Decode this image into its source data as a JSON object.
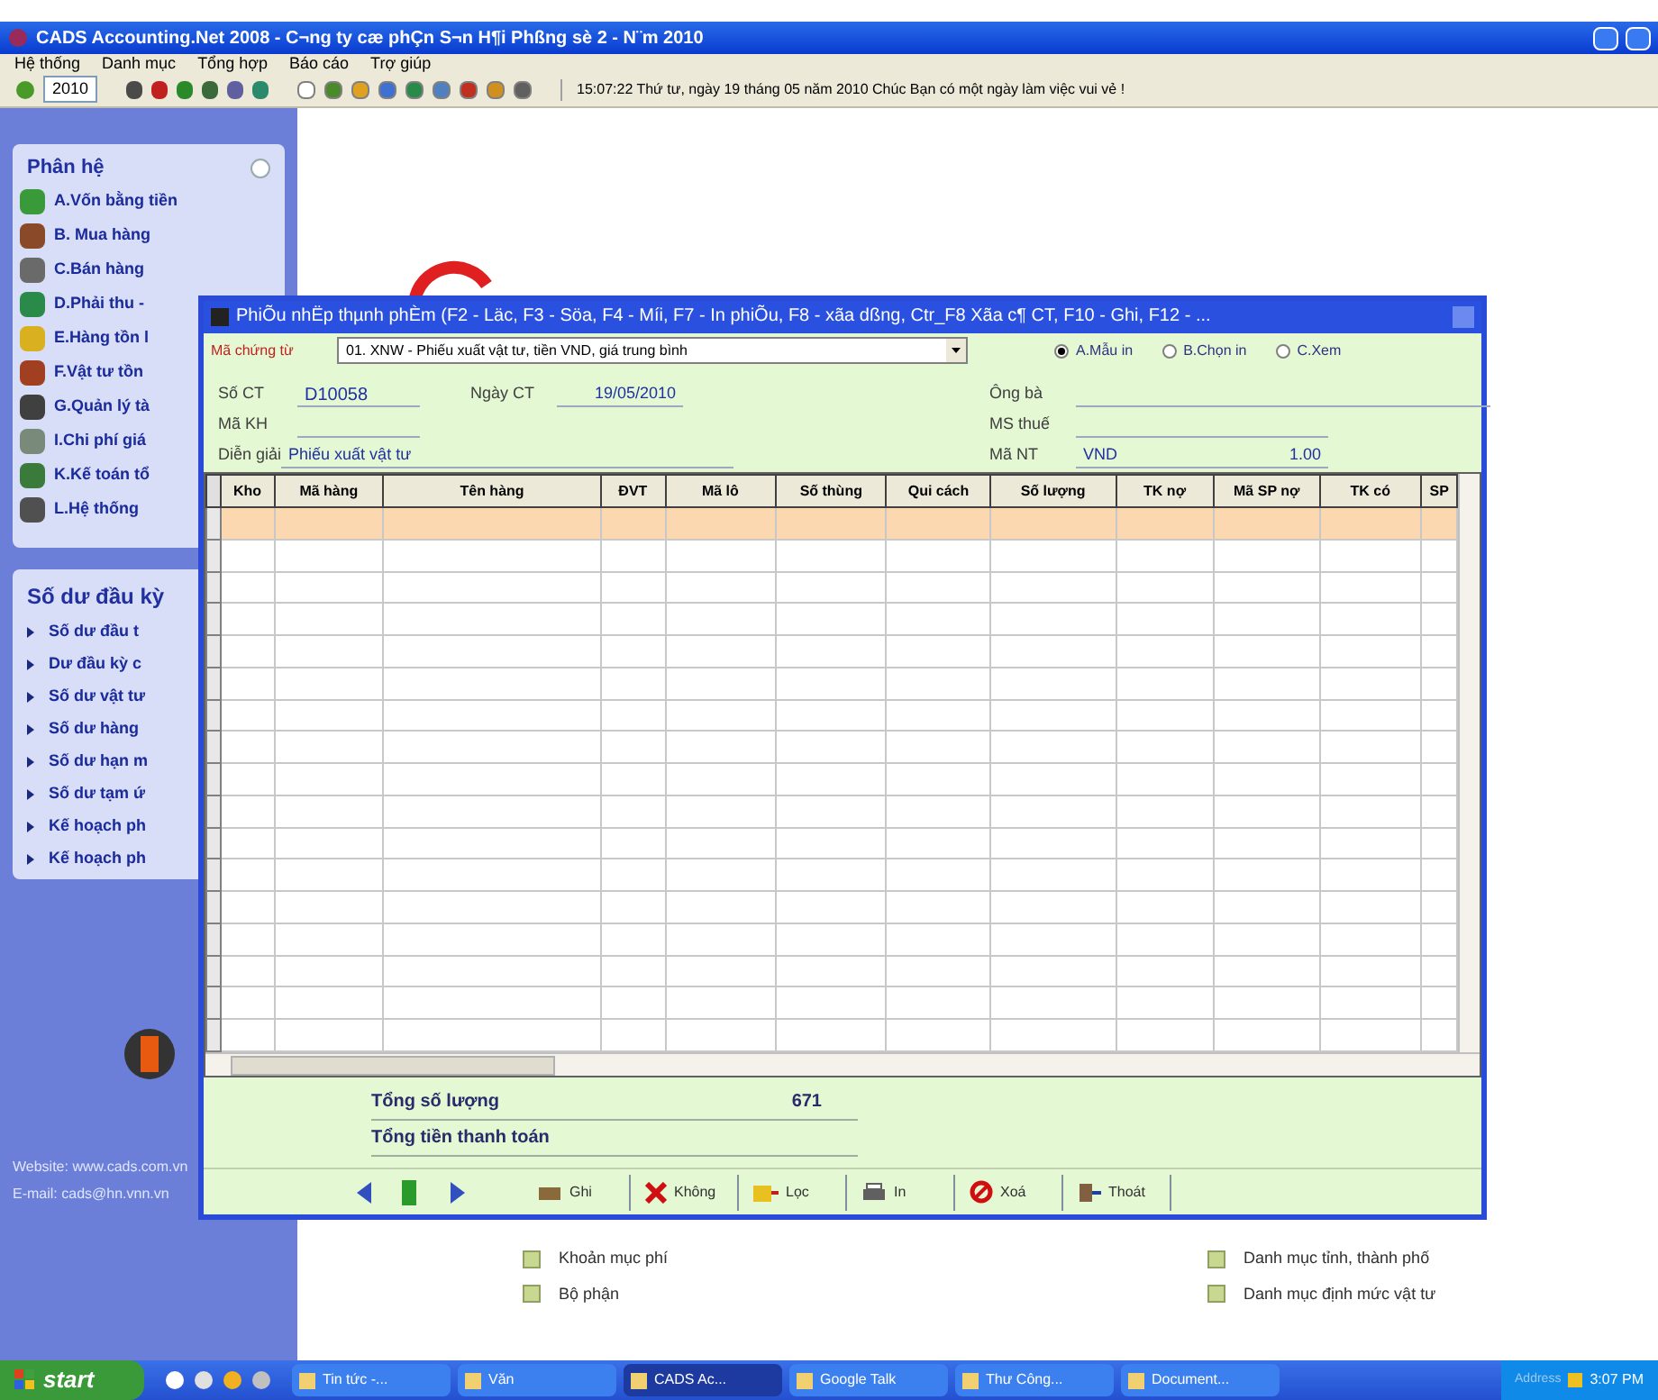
{
  "window": {
    "title": "CADS Accounting.Net 2008 - C¬ng ty cæ phÇn S¬n H¶i Phßng sè 2 - N¨m 2010"
  },
  "menu": [
    "Hệ thống",
    "Danh mục",
    "Tổng hợp",
    "Báo cáo",
    "Trợ giúp"
  ],
  "toolbar": {
    "year": "2010",
    "message": "15:07:22  Thứ tư, ngày 19 tháng 05 năm 2010  Chúc Bạn có một ngày làm việc vui vẻ !"
  },
  "modules": {
    "title": "Phân hệ",
    "items": [
      "A.Vốn bằng tiền",
      "B. Mua hàng",
      "C.Bán hàng",
      "D.Phải thu -",
      "E.Hàng tồn l",
      "F.Vật tư tồn",
      "G.Quản lý tà",
      "I.Chi phí giá",
      "K.Kế toán tổ",
      "L.Hệ thống"
    ]
  },
  "balances": {
    "title": "Số dư đầu kỳ",
    "items": [
      "Số dư đầu t",
      "Dư đầu kỳ c",
      "Số dư vật tư",
      "Số dư hàng",
      "Số dư hạn m",
      "Số dư tạm ứ",
      "Kế hoạch ph",
      "Kế hoạch ph"
    ]
  },
  "dialog": {
    "title": "PhiÕu nhËp thµnh phÈm (F2 - Läc, F3 - Söa, F4 - Míi, F7 - In phiÕu, F8 - xãa dßng, Ctr_F8 Xãa c¶ CT, F10 - Ghi, F12 - ...",
    "voucher_label": "Mã chứng từ",
    "voucher_value": "01. XNW - Phiếu xuất vật tư, tiền VND, giá trung bình",
    "print_options": [
      {
        "label": "A.Mẫu in",
        "selected": true
      },
      {
        "label": "B.Chọn in",
        "selected": false
      },
      {
        "label": "C.Xem",
        "selected": false
      }
    ],
    "fields_left": [
      {
        "label": "Số CT",
        "value": "D10058"
      },
      {
        "label": "Mã KH"
      },
      {
        "label": "Diễn giải",
        "value": "Phiếu xuất vật tư"
      }
    ],
    "date": {
      "label": "Ngày CT",
      "value": "19/05/2010"
    },
    "fields_right": [
      {
        "label": "Ông bà"
      },
      {
        "label": "MS thuế"
      },
      {
        "label": "Mã NT",
        "value": "VND"
      }
    ],
    "rate": "1.00",
    "table": {
      "columns": [
        "Kho",
        "Mã hàng",
        "Tên hàng",
        "ĐVT",
        "Mã lô",
        "Số thùng",
        "Qui cách",
        "Số lượng",
        "TK nợ",
        "Mã SP nợ",
        "TK có",
        "SP"
      ],
      "rows": [
        {
          "selected": true
        },
        {
          "selected": false
        },
        {
          "selected": false
        },
        {
          "selected": false
        },
        {
          "selected": false
        },
        {
          "selected": false
        },
        {
          "selected": false
        },
        {
          "selected": false
        },
        {
          "selected": false
        },
        {
          "selected": false
        },
        {
          "selected": false
        },
        {
          "selected": false
        },
        {
          "selected": false
        },
        {
          "selected": false
        },
        {
          "selected": false
        },
        {
          "selected": false
        },
        {
          "selected": false
        }
      ]
    },
    "totals": [
      {
        "label": "Tổng số lượng",
        "value": "671"
      },
      {
        "label": "Tổng tiền thanh toán"
      }
    ],
    "buttons": [
      {
        "kind": "save",
        "label": "Ghi"
      },
      {
        "kind": "cancel",
        "label": "Không"
      },
      {
        "kind": "filter",
        "label": "Lọc"
      },
      {
        "kind": "print",
        "label": "In"
      },
      {
        "kind": "delete",
        "label": "Xoá"
      },
      {
        "kind": "exit",
        "label": "Thoát"
      }
    ]
  },
  "links": [
    "Khoản mục phí",
    "Bộ phận",
    "Danh mục tỉnh, thành phố",
    "Danh mục định mức vật tư"
  ],
  "contact": [
    "Website: www.cads.com.vn",
    "E-mail: cads@hn.vnn.vn"
  ],
  "taskbar": {
    "start": "start",
    "tasks": [
      {
        "label": "Tin tức -...",
        "selected": false
      },
      {
        "label": "Văn",
        "selected": false
      },
      {
        "label": "CADS Ac...",
        "selected": true
      },
      {
        "label": "Google Talk",
        "selected": false
      },
      {
        "label": "Thư Công...",
        "selected": false
      },
      {
        "label": "Document...",
        "selected": false
      }
    ],
    "tray_label": "Address",
    "clock": "3:07 PM"
  }
}
